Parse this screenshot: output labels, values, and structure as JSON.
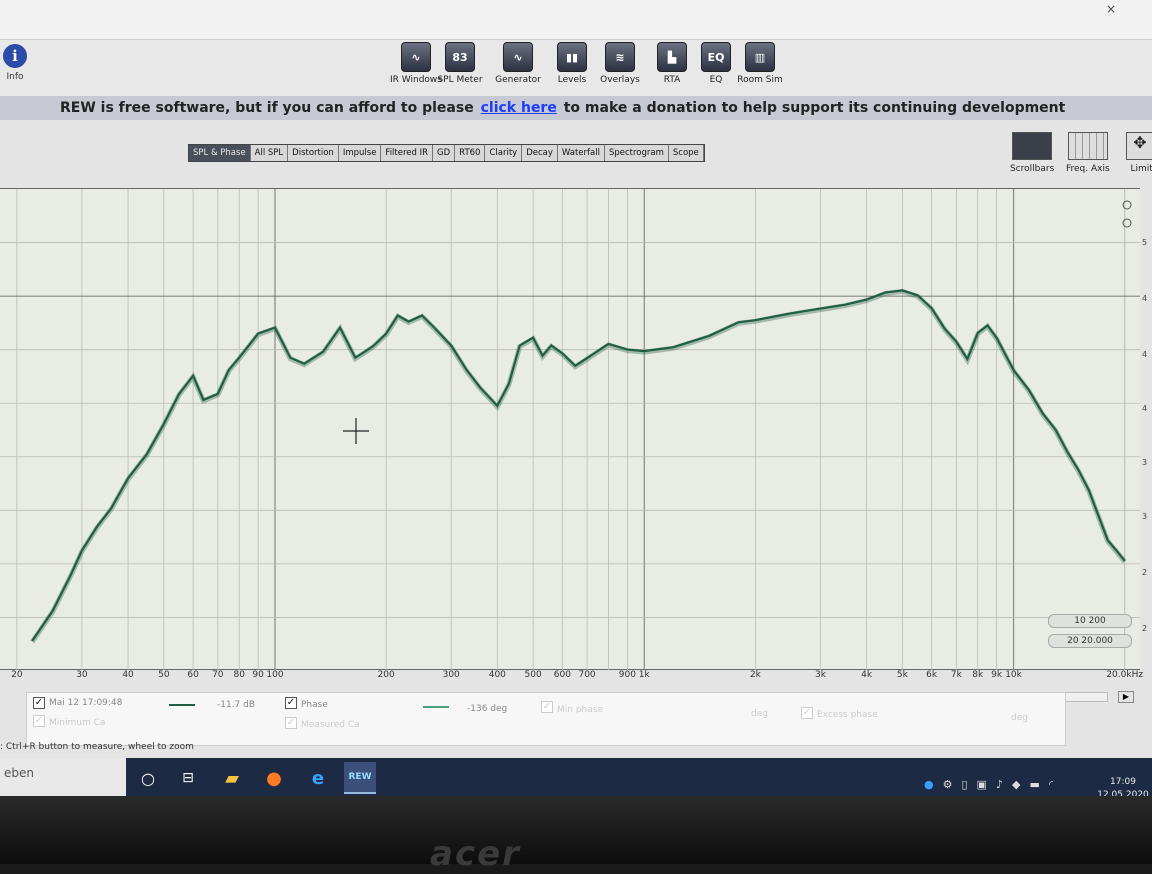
{
  "toolbar": {
    "info_label": "Info",
    "tools": [
      {
        "label": "IR Windows",
        "icon": "ir-windows-icon",
        "glyph": "∿"
      },
      {
        "label": "SPL Meter",
        "icon": "spl-meter-icon",
        "glyph": "83"
      },
      {
        "label": "Generator",
        "icon": "generator-icon",
        "glyph": "∿"
      },
      {
        "label": "Levels",
        "icon": "levels-icon",
        "glyph": "▮▮"
      },
      {
        "label": "Overlays",
        "icon": "overlays-icon",
        "glyph": "≋"
      },
      {
        "label": "RTA",
        "icon": "rta-icon",
        "glyph": "▙"
      },
      {
        "label": "EQ",
        "icon": "eq-icon",
        "glyph": "EQ"
      },
      {
        "label": "Room Sim",
        "icon": "room-sim-icon",
        "glyph": "▥"
      }
    ]
  },
  "banner": {
    "text_before": "REW is free software, but if you can afford to please",
    "link": "click here",
    "text_after": "to make a donation to help support its continuing development"
  },
  "tabs": [
    "SPL & Phase",
    "All SPL",
    "Distortion",
    "Impulse",
    "Filtered IR",
    "GD",
    "RT60",
    "Clarity",
    "Decay",
    "Waterfall",
    "Spectrogram",
    "Scope"
  ],
  "active_tab": 0,
  "side_controls": {
    "scrollbars": "Scrollbars",
    "freq_axis": "Freq. Axis",
    "limits": "Limits"
  },
  "zoom": {
    "btn1": "10  200",
    "btn2": "20  20.000"
  },
  "x_ticks": [
    "20",
    "30",
    "40",
    "50",
    "60",
    "70",
    "80",
    "90",
    "100",
    "200",
    "300",
    "400",
    "500",
    "600",
    "700",
    "900",
    "1k",
    "2k",
    "3k",
    "4k",
    "5k",
    "6k",
    "7k",
    "8k",
    "9k",
    "10k",
    "20.0kHz"
  ],
  "legend": {
    "measurement": "Mai 12 17:09:48",
    "spl_value": "-11.7 dB",
    "phase_label": "Phase",
    "phase_value": "-136 deg",
    "min_phase": "Min phase",
    "excess_phase": "Excess phase",
    "row2_a": "Minimum Ca",
    "row2_b": "Measured Ca",
    "deg_a": "deg",
    "deg_b": "deg"
  },
  "status_hint": ": Ctrl+R button to measure, wheel to zoom",
  "taskbar": {
    "search_text": "eben",
    "time": "17:09",
    "date": "12.05.2020"
  },
  "colors": {
    "trace": "#1f5e44",
    "accent": "#1a3cff"
  },
  "chart_data": {
    "type": "line",
    "xscale": "log",
    "xlim": [
      18,
      22000
    ],
    "series": [
      {
        "x": [
          22,
          25,
          28,
          30,
          33,
          36,
          40,
          45,
          50,
          55,
          60,
          64,
          70,
          75,
          80,
          90,
          100,
          110,
          120,
          135,
          150,
          165,
          175,
          185,
          200,
          215,
          230,
          250,
          270,
          300,
          330,
          360,
          400,
          430,
          460,
          500,
          530,
          560,
          600,
          650,
          700,
          800,
          900,
          1000,
          1200,
          1500,
          1800,
          2000,
          2500,
          3000,
          3500,
          4000,
          4500,
          5000,
          5500,
          6000,
          6500,
          7000,
          7500,
          8000,
          8500,
          9000,
          10000,
          11000,
          12000,
          13000,
          14000,
          15000,
          16000,
          17000,
          18000,
          19000,
          20000
        ],
        "y": [
          5,
          10,
          16,
          20,
          24,
          27,
          32,
          36,
          41,
          46,
          49,
          45,
          46,
          50,
          52,
          56,
          57,
          52,
          51,
          53,
          57,
          52,
          53,
          54,
          56,
          59,
          58,
          59,
          57,
          54,
          50,
          47,
          44,
          48,
          54,
          55,
          52,
          54,
          53,
          51,
          52,
          54,
          53,
          53,
          54,
          56,
          58,
          58,
          59,
          60,
          61,
          62,
          63,
          63,
          62,
          60,
          57,
          55,
          52,
          56,
          57,
          55,
          50,
          47,
          43,
          40,
          36,
          33,
          30,
          26,
          22,
          20,
          18
        ]
      }
    ]
  }
}
